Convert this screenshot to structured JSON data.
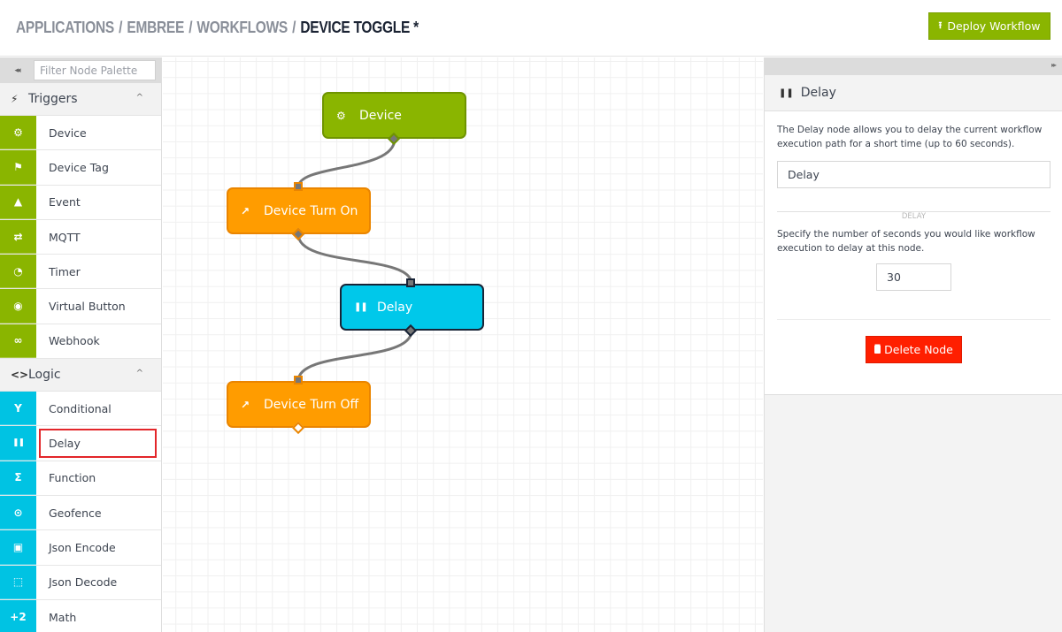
{
  "header": {
    "breadcrumb": [
      "APPLICATIONS",
      "EMBREE",
      "WORKFLOWS"
    ],
    "separator": "/",
    "current": "DEVICE TOGGLE *",
    "deploy_label": "Deploy Workflow",
    "deploy_icon": "upload-icon"
  },
  "palette": {
    "collapse_icon": "double-chevron-left-icon",
    "filter_placeholder": "Filter Node Palette",
    "filter_value": "",
    "categories": [
      {
        "label": "Triggers",
        "icon": "lightning-icon",
        "expanded": true,
        "color": "#8ab500",
        "items": [
          {
            "label": "Device",
            "icon": "chip-icon"
          },
          {
            "label": "Device Tag",
            "icon": "flag-icon"
          },
          {
            "label": "Event",
            "icon": "warning-icon"
          },
          {
            "label": "MQTT",
            "icon": "arrows-exchange-icon"
          },
          {
            "label": "Timer",
            "icon": "stopwatch-icon"
          },
          {
            "label": "Virtual Button",
            "icon": "radio-button-icon"
          },
          {
            "label": "Webhook",
            "icon": "link-icon"
          }
        ]
      },
      {
        "label": "Logic",
        "icon": "code-brackets-icon",
        "expanded": true,
        "color": "#00c3e3",
        "items": [
          {
            "label": "Conditional",
            "icon": "fork-icon"
          },
          {
            "label": "Delay",
            "icon": "pause-icon",
            "selected": true
          },
          {
            "label": "Function",
            "icon": "sigma-icon"
          },
          {
            "label": "Geofence",
            "icon": "crosshair-icon"
          },
          {
            "label": "Json Encode",
            "icon": "json-encode-icon"
          },
          {
            "label": "Json Decode",
            "icon": "json-decode-icon"
          },
          {
            "label": "Math",
            "icon": "plus-two-icon"
          }
        ]
      }
    ]
  },
  "icons": {
    "chip": "⚙",
    "flag": "⚑",
    "warning": "▲",
    "exchange": "⇄",
    "stopwatch": "◔",
    "radio": "◉",
    "link": "∞",
    "fork": "Y",
    "pause": "❚❚",
    "sigma": "Σ",
    "crosshair": "⊙",
    "encode": "▣",
    "decode": "⬚",
    "math": "+2",
    "arrow": "↗",
    "lightning": "⚡",
    "code": "<>",
    "chev_up": "^",
    "upload": "⭱",
    "trash": "🗑",
    "collapse": "◂◂",
    "expand": "▸▸"
  },
  "canvas": {
    "nodes": [
      {
        "id": "device",
        "label": "Device",
        "type": "trigger",
        "icon": "chip-icon",
        "color": "#8ab500"
      },
      {
        "id": "turn-on",
        "label": "Device Turn On",
        "type": "action",
        "icon": "arrow-up-right-icon",
        "color": "#ff9c00"
      },
      {
        "id": "delay",
        "label": "Delay",
        "type": "logic",
        "icon": "pause-icon",
        "color": "#00c8ea",
        "selected": true
      },
      {
        "id": "turn-off",
        "label": "Device Turn Off",
        "type": "action",
        "icon": "arrow-up-right-icon",
        "color": "#ff9c00"
      }
    ],
    "edges": [
      {
        "from": "device",
        "to": "turn-on"
      },
      {
        "from": "turn-on",
        "to": "delay"
      },
      {
        "from": "delay",
        "to": "turn-off"
      }
    ]
  },
  "panel": {
    "expand_icon": "double-chevron-right-icon",
    "title": "Delay",
    "title_icon": "pause-icon",
    "description": "The Delay node allows you to delay the current workflow execution path for a short time (up to 60 seconds).",
    "name_value": "Delay",
    "section_label": "DELAY",
    "seconds_description": "Specify the number of seconds you would like workflow execution to delay at this node.",
    "seconds_value": "30",
    "delete_label": "Delete Node",
    "delete_icon": "trash-icon"
  }
}
